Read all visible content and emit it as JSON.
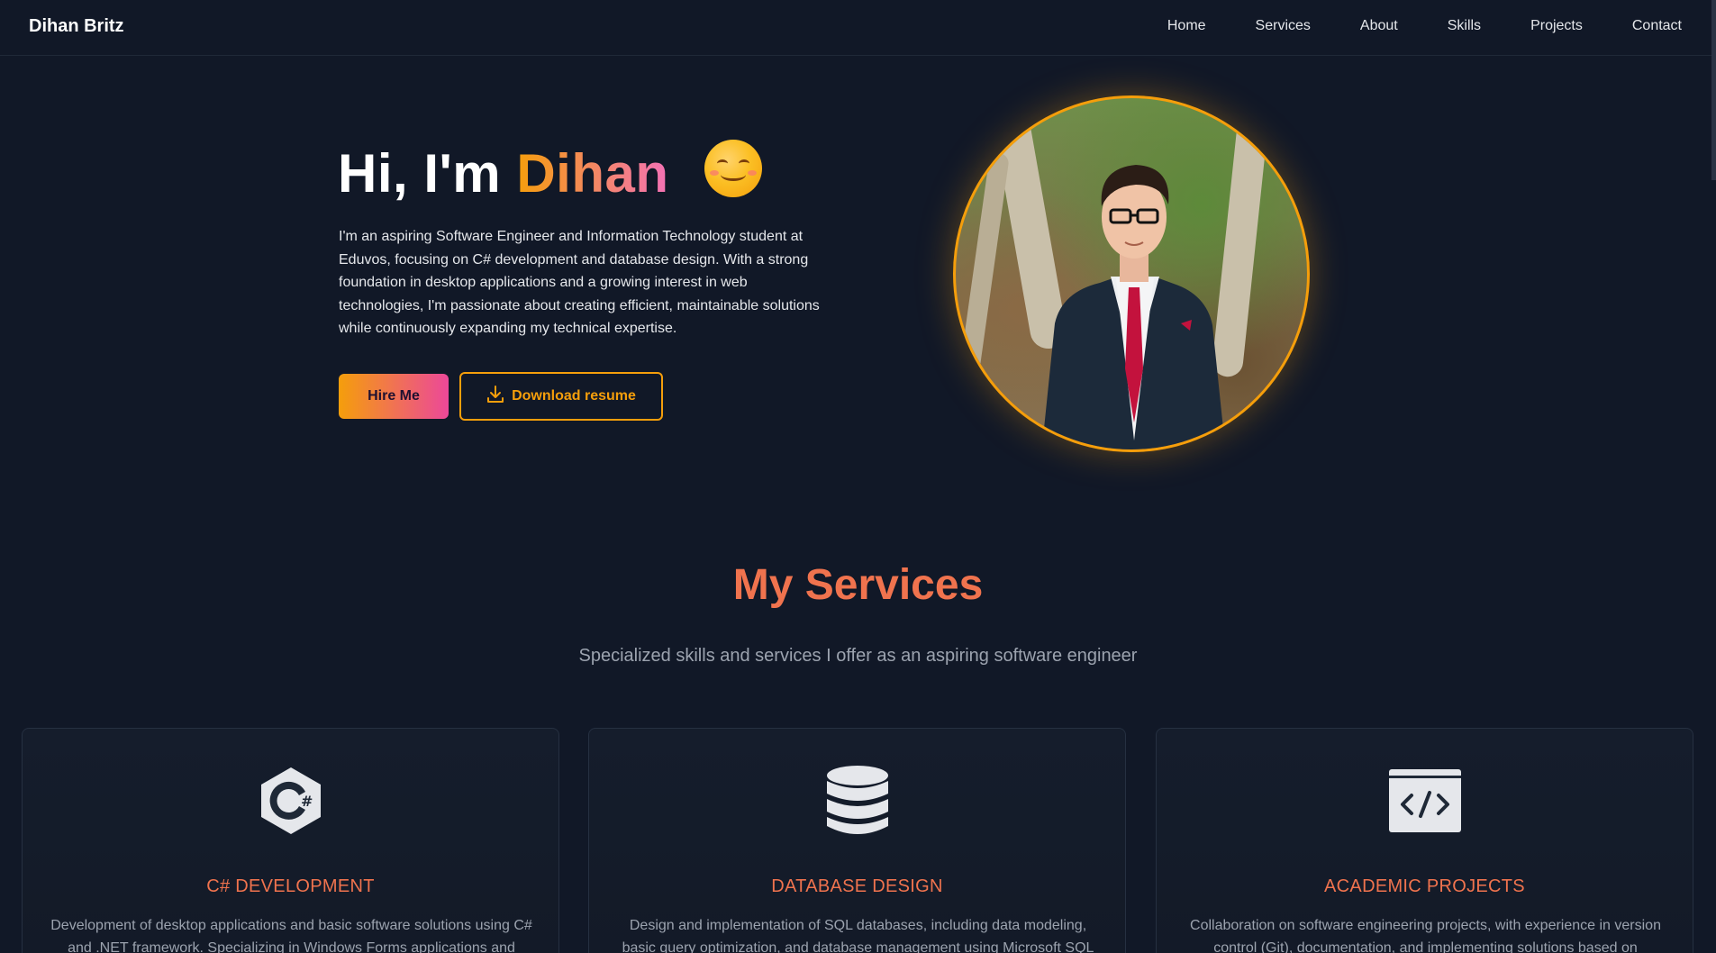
{
  "nav": {
    "brand": "Dihan Britz",
    "links": [
      "Home",
      "Services",
      "About",
      "Skills",
      "Projects",
      "Contact"
    ]
  },
  "hero": {
    "greeting": "Hi, I'm",
    "name": "Dihan",
    "emoji_icon": "smiling-face-icon",
    "description": "I'm an aspiring Software Engineer and Information Technology student at Eduvos, focusing on C# development and database design. With a strong foundation in desktop applications and a growing interest in web technologies, I'm passionate about creating efficient, maintainable solutions while continuously expanding my technical expertise.",
    "hire_label": "Hire Me",
    "download_label": "Download resume",
    "download_icon": "download-icon"
  },
  "services": {
    "title": "My Services",
    "subtitle": "Specialized skills and services I offer as an aspiring software engineer",
    "cards": [
      {
        "icon": "csharp-icon",
        "title": "C# DEVELOPMENT",
        "description": "Development of desktop applications and basic software solutions using C# and .NET framework. Specializing in Windows Forms applications and"
      },
      {
        "icon": "database-icon",
        "title": "DATABASE DESIGN",
        "description": "Design and implementation of SQL databases, including data modeling, basic query optimization, and database management using Microsoft SQL Server."
      },
      {
        "icon": "code-window-icon",
        "title": "ACADEMIC PROJECTS",
        "description": "Collaboration on software engineering projects, with experience in version control (Git), documentation, and implementing solutions based on academic"
      }
    ]
  },
  "colors": {
    "background": "#111827",
    "accent_orange": "#f59e0b",
    "accent_pink": "#ec4899",
    "heading_coral": "#f0734e"
  }
}
